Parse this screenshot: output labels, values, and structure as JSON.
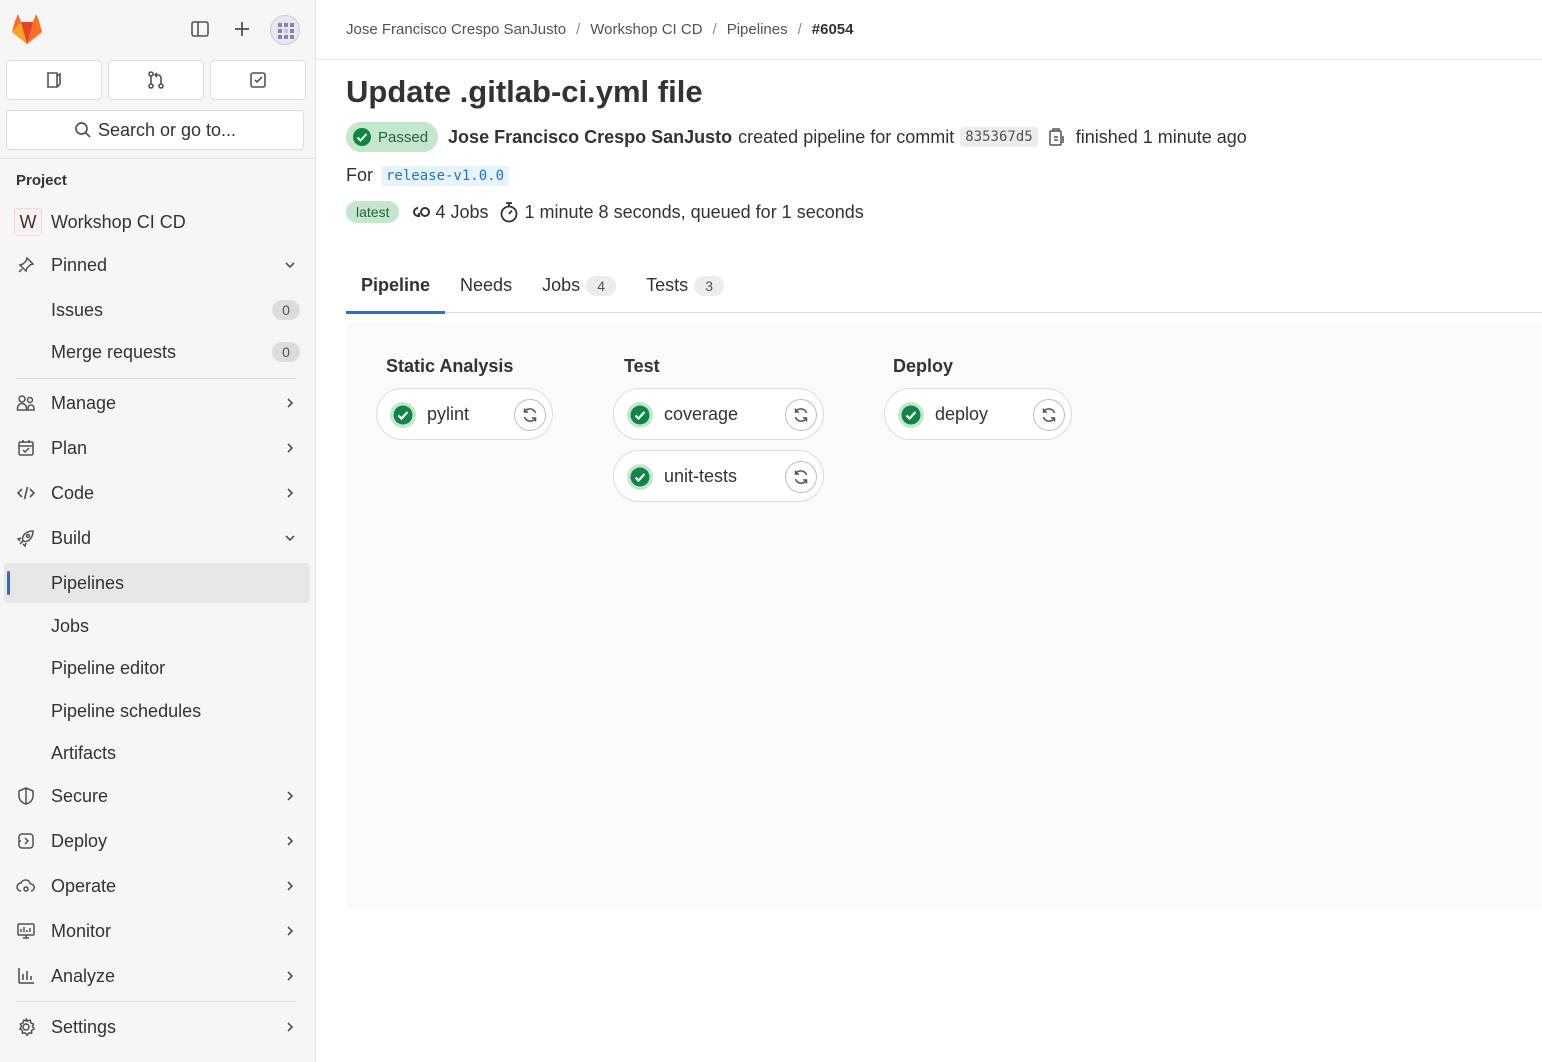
{
  "sidebar": {
    "search_placeholder": "Search or go to...",
    "section_label": "Project",
    "project": {
      "initial": "W",
      "name": "Workshop CI CD"
    },
    "pinned": {
      "label": "Pinned",
      "items": [
        {
          "label": "Issues",
          "count": "0"
        },
        {
          "label": "Merge requests",
          "count": "0"
        }
      ]
    },
    "groups": [
      {
        "label": "Manage"
      },
      {
        "label": "Plan"
      },
      {
        "label": "Code"
      },
      {
        "label": "Build"
      }
    ],
    "build_items": [
      "Pipelines",
      "Jobs",
      "Pipeline editor",
      "Pipeline schedules",
      "Artifacts"
    ],
    "groups_after": [
      "Secure",
      "Deploy",
      "Operate",
      "Monitor",
      "Analyze"
    ],
    "settings_label": "Settings"
  },
  "breadcrumb": [
    "Jose Francisco Crespo SanJusto",
    "Workshop CI CD",
    "Pipelines",
    "#6054"
  ],
  "pipeline": {
    "title": "Update .gitlab-ci.yml file",
    "status": "Passed",
    "author": "Jose Francisco Crespo SanJusto",
    "created_text": "created pipeline for commit",
    "commit_sha": "835367d5",
    "finished_text": "finished 1 minute ago",
    "for_label": "For",
    "ref": "release-v1.0.0",
    "latest_badge": "latest",
    "jobs_count": "4 Jobs",
    "duration_text": "1 minute 8 seconds, queued for 1 seconds"
  },
  "tabs": [
    {
      "label": "Pipeline",
      "count": null
    },
    {
      "label": "Needs",
      "count": null
    },
    {
      "label": "Jobs",
      "count": "4"
    },
    {
      "label": "Tests",
      "count": "3"
    }
  ],
  "stages": [
    {
      "name": "Static Analysis",
      "jobs": [
        "pylint"
      ]
    },
    {
      "name": "Test",
      "jobs": [
        "coverage",
        "unit-tests"
      ]
    },
    {
      "name": "Deploy",
      "jobs": [
        "deploy"
      ]
    }
  ],
  "colors": {
    "accent": "#1f75cb",
    "success": "#108548",
    "success_bg": "#c3e6cd"
  }
}
